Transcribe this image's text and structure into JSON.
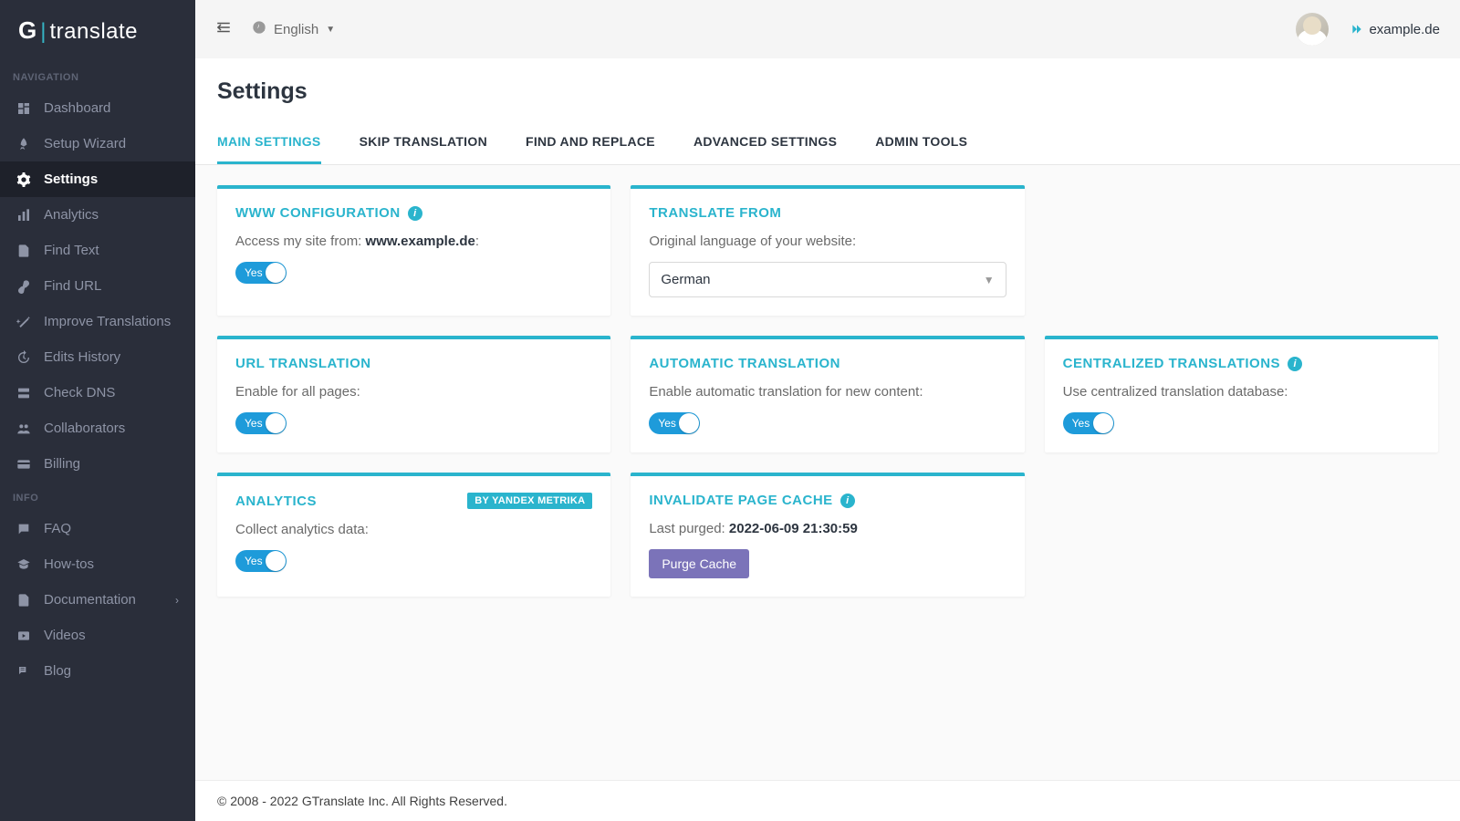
{
  "brand": {
    "g": "G",
    "sep": "|",
    "name": "translate"
  },
  "sidebar": {
    "nav_header": "NAVIGATION",
    "info_header": "INFO",
    "items": [
      {
        "label": "Dashboard",
        "icon": "dashboard-icon"
      },
      {
        "label": "Setup Wizard",
        "icon": "rocket-icon"
      },
      {
        "label": "Settings",
        "icon": "gear-icon",
        "active": true
      },
      {
        "label": "Analytics",
        "icon": "bar-chart-icon"
      },
      {
        "label": "Find Text",
        "icon": "search-file-icon"
      },
      {
        "label": "Find URL",
        "icon": "link-icon"
      },
      {
        "label": "Improve Translations",
        "icon": "wand-icon"
      },
      {
        "label": "Edits History",
        "icon": "history-icon"
      },
      {
        "label": "Check DNS",
        "icon": "server-icon"
      },
      {
        "label": "Collaborators",
        "icon": "people-icon"
      },
      {
        "label": "Billing",
        "icon": "card-icon"
      }
    ],
    "info_items": [
      {
        "label": "FAQ",
        "icon": "chat-icon"
      },
      {
        "label": "How-tos",
        "icon": "graduation-icon"
      },
      {
        "label": "Documentation",
        "icon": "doc-icon",
        "chevron": true
      },
      {
        "label": "Videos",
        "icon": "play-icon"
      },
      {
        "label": "Blog",
        "icon": "blog-icon"
      }
    ]
  },
  "topbar": {
    "language": "English",
    "domain": "example.de"
  },
  "page": {
    "title": "Settings"
  },
  "tabs": [
    {
      "label": "MAIN SETTINGS",
      "active": true
    },
    {
      "label": "SKIP TRANSLATION"
    },
    {
      "label": "FIND AND REPLACE"
    },
    {
      "label": "ADVANCED SETTINGS"
    },
    {
      "label": "ADMIN TOOLS"
    }
  ],
  "cards": {
    "www": {
      "title": "WWW CONFIGURATION",
      "text_pre": "Access my site from: ",
      "text_bold": "www.example.de",
      "text_post": ":",
      "toggle": "Yes"
    },
    "translate_from": {
      "title": "TRANSLATE FROM",
      "text": "Original language of your website:",
      "value": "German"
    },
    "url_translation": {
      "title": "URL TRANSLATION",
      "text": "Enable for all pages:",
      "toggle": "Yes"
    },
    "automatic": {
      "title": "AUTOMATIC TRANSLATION",
      "text": "Enable automatic translation for new content:",
      "toggle": "Yes"
    },
    "centralized": {
      "title": "CENTRALIZED TRANSLATIONS",
      "text": "Use centralized translation database:",
      "toggle": "Yes"
    },
    "analytics": {
      "title": "ANALYTICS",
      "badge": "BY YANDEX METRIKA",
      "text": "Collect analytics data:",
      "toggle": "Yes"
    },
    "invalidate": {
      "title": "INVALIDATE PAGE CACHE",
      "text_pre": "Last purged: ",
      "text_bold": "2022-06-09 21:30:59",
      "button": "Purge Cache"
    }
  },
  "footer": "© 2008 - 2022 GTranslate Inc. All Rights Reserved."
}
